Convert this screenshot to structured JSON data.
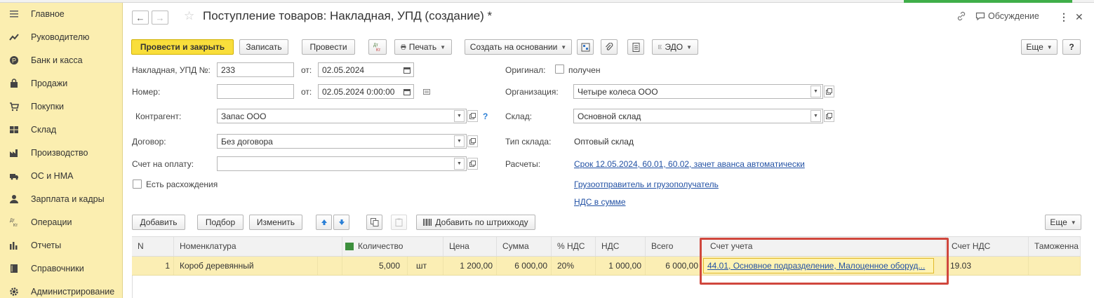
{
  "sidebar": {
    "items": [
      {
        "label": "Главное",
        "icon": "menu-icon"
      },
      {
        "label": "Руководителю",
        "icon": "trend-icon"
      },
      {
        "label": "Банк и касса",
        "icon": "coin-icon"
      },
      {
        "label": "Продажи",
        "icon": "bag-icon"
      },
      {
        "label": "Покупки",
        "icon": "cart-icon"
      },
      {
        "label": "Склад",
        "icon": "warehouse-icon"
      },
      {
        "label": "Производство",
        "icon": "factory-icon"
      },
      {
        "label": "ОС и НМА",
        "icon": "truck-icon"
      },
      {
        "label": "Зарплата и кадры",
        "icon": "person-icon"
      },
      {
        "label": "Операции",
        "icon": "dt-kt-icon"
      },
      {
        "label": "Отчеты",
        "icon": "bar-chart-icon"
      },
      {
        "label": "Справочники",
        "icon": "book-icon"
      },
      {
        "label": "Администрирование",
        "icon": "gear-icon"
      }
    ]
  },
  "header": {
    "title": "Поступление товаров: Накладная, УПД (создание) *",
    "discussion": "Обсуждение"
  },
  "toolbar": {
    "post_close": "Провести и закрыть",
    "save": "Записать",
    "post": "Провести",
    "dtkt_top": "Дт",
    "dtkt_bottom": "Кт",
    "print": "Печать",
    "create_based": "Создать на основании",
    "edo": "ЭДО",
    "more": "Еще",
    "help": "?"
  },
  "form": {
    "invoice_label": "Накладная, УПД №:",
    "invoice_number": "233",
    "from_label": "от:",
    "invoice_date": "02.05.2024",
    "number_label": "Номер:",
    "number_value": "",
    "from_label2": "от:",
    "number_date": "02.05.2024  0:00:00",
    "counterparty_label": "Контрагент:",
    "counterparty": "Запас ООО",
    "contract_label": "Договор:",
    "contract": "Без договора",
    "payment_account_label": "Счет на оплату:",
    "payment_account": "",
    "discrepancies_label": "Есть расхождения",
    "original_label": "Оригинал:",
    "original_value": "получен",
    "organization_label": "Организация:",
    "organization": "Четыре колеса ООО",
    "warehouse_label": "Склад:",
    "warehouse": "Основной склад",
    "warehouse_type_label": "Тип склада:",
    "warehouse_type": "Оптовый склад",
    "settlements_label": "Расчеты:",
    "settlements_link": "Срок 12.05.2024, 60.01, 60.02, зачет аванса автоматически",
    "shipper_link": "Грузоотправитель и грузополучатель",
    "vat_link": "НДС в сумме"
  },
  "table_toolbar": {
    "add": "Добавить",
    "select": "Подбор",
    "edit": "Изменить",
    "add_barcode": "Добавить по штрихкоду",
    "more": "Еще"
  },
  "table": {
    "columns": [
      "N",
      "Номенклатура",
      "Количество",
      "Цена",
      "Сумма",
      "% НДС",
      "НДС",
      "Всего",
      "Счет учета",
      "Счет НДС",
      "Таможенна"
    ],
    "rows": [
      {
        "n": "1",
        "item": "Короб деревянный",
        "qty": "5,000",
        "unit": "шт",
        "price": "1 200,00",
        "sum": "6 000,00",
        "vat_rate": "20%",
        "vat": "1 000,00",
        "total": "6 000,00",
        "account": "44.01, Основное подразделение, Малоценное оборуд...",
        "vat_account": "19.03",
        "customs": ""
      }
    ]
  }
}
